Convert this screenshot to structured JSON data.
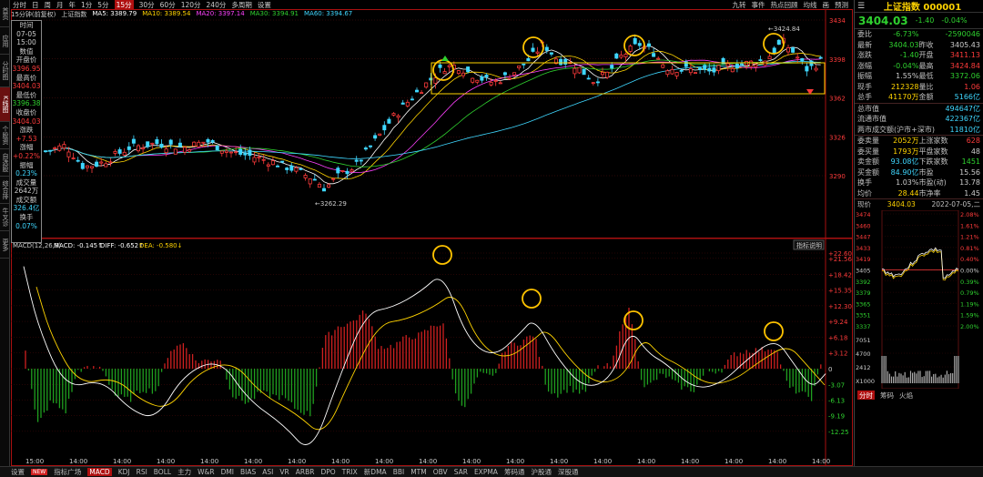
{
  "left_tabs": [
    "首页",
    "应用",
    "分时图",
    "K线图",
    "个股资料",
    "自选股",
    "综合排名",
    "牛叉诊断",
    "更多"
  ],
  "period_tabs": [
    "分时",
    "日",
    "周",
    "月",
    "年",
    "1分",
    "5分",
    "15分",
    "30分",
    "60分",
    "120分",
    "240分",
    "多周期",
    "设置"
  ],
  "active_period": "15分",
  "toolbar_right": [
    "九转",
    "事件",
    "热点回顾",
    "均线",
    "画",
    "预测"
  ],
  "ma_line": {
    "title": "15分钟(前复权)",
    "name": "上证指数",
    "ma5": "MA5: 3389.79",
    "ma10": "MA10: 3389.54",
    "ma20": "MA20: 3397.14",
    "ma30": "MA30: 3394.91",
    "ma60": "MA60: 3394.67"
  },
  "infobox": [
    {
      "t": "时间",
      "c": "#cccccc"
    },
    {
      "t": "07-05",
      "c": "#cccccc"
    },
    {
      "t": "15:00",
      "c": "#cccccc"
    },
    {
      "t": "数值",
      "c": "#cccccc"
    },
    {
      "t": "开盘价",
      "c": "#cccccc"
    },
    {
      "t": "3396.95",
      "c": "#ff3b3b"
    },
    {
      "t": "最高价",
      "c": "#cccccc"
    },
    {
      "t": "3404.03",
      "c": "#ff3b3b"
    },
    {
      "t": "最低价",
      "c": "#cccccc"
    },
    {
      "t": "3396.38",
      "c": "#2fd12f"
    },
    {
      "t": "收盘价",
      "c": "#cccccc"
    },
    {
      "t": "3404.03",
      "c": "#ff3b3b"
    },
    {
      "t": "涨跌",
      "c": "#cccccc"
    },
    {
      "t": "+7.53",
      "c": "#ff3b3b"
    },
    {
      "t": "涨幅",
      "c": "#cccccc"
    },
    {
      "t": "+0.22%",
      "c": "#ff3b3b"
    },
    {
      "t": "振幅",
      "c": "#cccccc"
    },
    {
      "t": "0.23%",
      "c": "#3fd7ff"
    },
    {
      "t": "成交量",
      "c": "#cccccc"
    },
    {
      "t": "2642万",
      "c": "#cccccc"
    },
    {
      "t": "成交额",
      "c": "#cccccc"
    },
    {
      "t": "326.4亿",
      "c": "#3fd7ff"
    },
    {
      "t": "换手",
      "c": "#cccccc"
    },
    {
      "t": "0.07%",
      "c": "#3fd7ff"
    }
  ],
  "price_axis": [
    "3434",
    "3398",
    "3362",
    "3326",
    "3290"
  ],
  "annotations": {
    "high": "3424.84",
    "low": "3262.29"
  },
  "macd": {
    "label": "MACD(12,26,9)",
    "macd": "MACD: -0.145↑",
    "diff": "DIFF: -0.652↑",
    "dea": "DEA: -0.580↓",
    "indicator_button": "指标说明",
    "axis": [
      "+22.60",
      "+21.56",
      "+18.42",
      "+15.35",
      "+12.30",
      "+9.24",
      "+6.18",
      "+3.12",
      "0",
      "-3.07",
      "-6.13",
      "-9.19",
      "-12.25"
    ]
  },
  "time_axis": [
    "15:00",
    "14:00",
    "14:00",
    "14:00",
    "14:00",
    "14:00",
    "14:00",
    "14:00",
    "14:00",
    "14:00",
    "14:00",
    "14:00",
    "14:00",
    "14:00",
    "14:00",
    "14:00",
    "14:00",
    "14:00",
    "14:00"
  ],
  "right_panel": {
    "title": "上证指数 000001",
    "price": "3404.03",
    "change": "-1.40",
    "pct": "-0.04%",
    "rows1": [
      {
        "l": "委比",
        "v": "-6.73%",
        "vc": "#2fd12f",
        "l2": "",
        "v2": "-2590046",
        "v2c": "#2fd12f"
      },
      {
        "l": "最新",
        "v": "3404.03",
        "vc": "#2fd12f",
        "l2": "昨收",
        "v2": "3405.43",
        "v2c": "#cccccc"
      },
      {
        "l": "涨跌",
        "v": "-1.40",
        "vc": "#2fd12f",
        "l2": "开盘",
        "v2": "3411.13",
        "v2c": "#ff3b3b"
      },
      {
        "l": "涨幅",
        "v": "-0.04%",
        "vc": "#2fd12f",
        "l2": "最高",
        "v2": "3424.84",
        "v2c": "#ff3b3b"
      },
      {
        "l": "振幅",
        "v": "1.55%",
        "vc": "#cccccc",
        "l2": "最低",
        "v2": "3372.06",
        "v2c": "#2fd12f"
      },
      {
        "l": "现手",
        "v": "212328",
        "vc": "#ffd400",
        "l2": "量比",
        "v2": "1.06",
        "v2c": "#ff3b3b"
      },
      {
        "l": "总手",
        "v": "41170万",
        "vc": "#ffd400",
        "l2": "金额",
        "v2": "5166亿",
        "v2c": "#3fd7ff"
      }
    ],
    "rows2": [
      {
        "l": "总市值",
        "v": "494647亿",
        "vc": "#3fd7ff"
      },
      {
        "l": "流通市值",
        "v": "422367亿",
        "vc": "#3fd7ff"
      },
      {
        "l": "两市成交额(沪市+深市)",
        "v": "11810亿",
        "vc": "#3fd7ff"
      }
    ],
    "rows3": [
      {
        "l": "委卖量",
        "v": "2052万",
        "vc": "#ffd400",
        "l2": "上涨家数",
        "v2": "628",
        "v2c": "#ff3b3b"
      },
      {
        "l": "委买量",
        "v": "1793万",
        "vc": "#ffd400",
        "l2": "平盘家数",
        "v2": "48",
        "v2c": "#cccccc"
      },
      {
        "l": "卖金额",
        "v": "93.08亿",
        "vc": "#3fd7ff",
        "l2": "下跌家数",
        "v2": "1451",
        "v2c": "#2fd12f"
      },
      {
        "l": "买金额",
        "v": "84.90亿",
        "vc": "#3fd7ff",
        "l2": "市盈",
        "v2": "15.56",
        "v2c": "#cccccc"
      },
      {
        "l": "换手",
        "v": "1.03%",
        "vc": "#cccccc",
        "l2": "市盈(动)",
        "v2": "13.78",
        "v2c": "#cccccc"
      },
      {
        "l": "均价",
        "v": "28.44",
        "vc": "#ffd400",
        "l2": "市净率",
        "v2": "1.45",
        "v2c": "#cccccc"
      }
    ],
    "mini_header": {
      "label": "现价",
      "price": "3404.03",
      "date": "2022-07-05,二"
    },
    "mini_axis_left": [
      "3474",
      "3460",
      "3447",
      "3433",
      "3419",
      "3405",
      "3392",
      "3379",
      "3365",
      "3351",
      "3337",
      "7051",
      "4700",
      "2412",
      "X1000"
    ],
    "mini_axis_right": [
      "2.08%",
      "1.61%",
      "1.21%",
      "0.81%",
      "0.40%",
      "0.00%",
      "0.39%",
      "0.79%",
      "1.19%",
      "1.59%",
      "2.00%"
    ],
    "bottom_tabs": [
      "分时",
      "筹码",
      "火焰"
    ]
  },
  "bottom_tabs": [
    "设置",
    "NEW",
    "指标广场",
    "MACD",
    "KDJ",
    "RSI",
    "BOLL",
    "主力",
    "W&R",
    "DMI",
    "BIAS",
    "ASI",
    "VR",
    "ARBR",
    "DPO",
    "TRIX",
    "新DMA",
    "BBI",
    "MTM",
    "OBV",
    "SAR",
    "EXPMA",
    "筹码通",
    "沪股通",
    "深股通"
  ],
  "bottom_active": "MACD",
  "colors": {
    "up": "#ff3b3b",
    "down": "#2fd12f",
    "ma5": "#ffffff",
    "ma10": "#ffd400",
    "ma20": "#ff40ff",
    "ma30": "#2fd12f",
    "ma60": "#3fd7ff",
    "highlight": "#ffc400"
  }
}
